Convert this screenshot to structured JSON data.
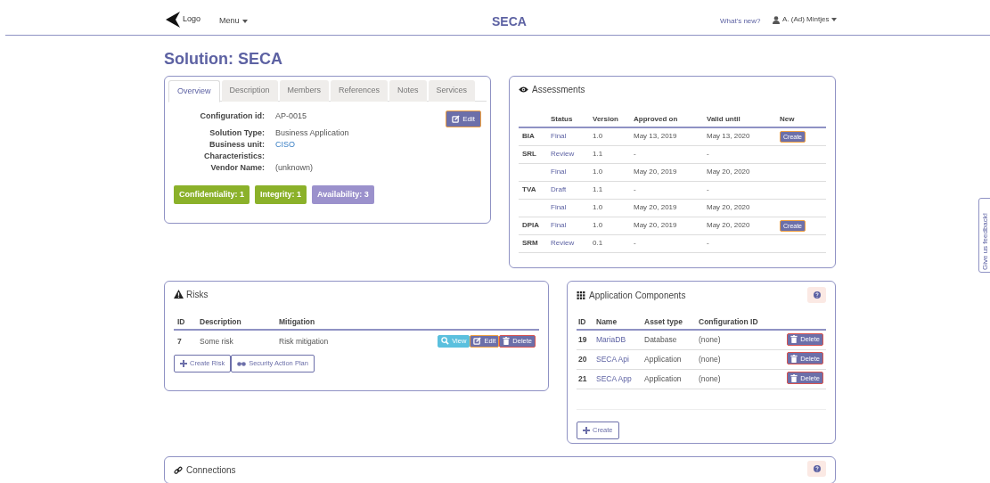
{
  "header": {
    "logo_text": "Logo",
    "menu": "Menu",
    "app_title": "SECA",
    "whats_new": "What's new?",
    "user": "A. (Ad) Mintjes"
  },
  "page_title": "Solution: SECA",
  "overview": {
    "tabs": [
      {
        "label": "Overview",
        "selected": true
      },
      {
        "label": "Description",
        "selected": false
      },
      {
        "label": "Members",
        "selected": false
      },
      {
        "label": "References",
        "selected": false
      },
      {
        "label": "Notes",
        "selected": false
      },
      {
        "label": "Services",
        "selected": false
      }
    ],
    "edit_button": "Edit",
    "fields": [
      {
        "label": "Configuration id:",
        "value": "AP-0015",
        "kind": "text"
      },
      {
        "label": "Solution Type:",
        "value": "Business Application",
        "kind": "text"
      },
      {
        "label": "Business unit:",
        "value": "CISO",
        "kind": "link"
      },
      {
        "label": "Characteristics:"
      },
      {
        "label": "Vendor Name:",
        "value": "(unknown)",
        "kind": "text"
      }
    ],
    "badges": [
      {
        "label": "Confidentiality: 1",
        "color": "#8bb12a"
      },
      {
        "label": "Integrity: 1",
        "color": "#8bb12a"
      },
      {
        "label": "Availability: 3",
        "color": "#9b91cc"
      }
    ]
  },
  "assessments": {
    "title": "Assessments",
    "columns": [
      "Status",
      "Version",
      "Approved on",
      "Valid until",
      "New"
    ],
    "rows": [
      {
        "type": "BIA",
        "status": "Final",
        "version": "1.0",
        "approved_on": "May 13, 2019",
        "valid_until": "May 13, 2020",
        "new_button": "Create"
      },
      {
        "type": "SRL",
        "status": "Review",
        "version": "1.1",
        "approved_on": "-",
        "valid_until": "-"
      },
      {
        "status": "Final",
        "version": "1.0",
        "approved_on": "May 20, 2019",
        "valid_until": "May 20, 2020"
      },
      {
        "type": "TVA",
        "status": "Draft",
        "version": "1.1",
        "approved_on": "-",
        "valid_until": "-"
      },
      {
        "status": "Final",
        "version": "1.0",
        "approved_on": "May 20, 2019",
        "valid_until": "May 20, 2020"
      },
      {
        "type": "DPIA",
        "status": "Final",
        "version": "1.0",
        "approved_on": "May 20, 2019",
        "valid_until": "May 20, 2020",
        "new_button": "Create"
      },
      {
        "type": "SRM",
        "status": "Review",
        "version": "0.1",
        "approved_on": "-",
        "valid_until": "-"
      }
    ]
  },
  "risks": {
    "title": "Risks",
    "columns": [
      "ID",
      "Description",
      "Mitigation"
    ],
    "rows": [
      {
        "id": "7",
        "description": "Some risk",
        "mitigation": "Risk mitigation",
        "actions": [
          {
            "label": "View",
            "kind": "view"
          },
          {
            "label": "Edit",
            "kind": "edit"
          },
          {
            "label": "Delete",
            "kind": "delete"
          }
        ]
      }
    ],
    "buttons": [
      {
        "label": "Create Risk",
        "kind": "create"
      },
      {
        "label": "Security Action Plan",
        "kind": "plan"
      }
    ]
  },
  "components": {
    "title": "Application Components",
    "columns": [
      "ID",
      "Name",
      "Asset type",
      "Configuration ID"
    ],
    "rows": [
      {
        "id": "19",
        "name": "MariaDB",
        "asset_type": "Database",
        "configuration_id": "(none)",
        "action": "Delete"
      },
      {
        "id": "20",
        "name": "SECA Api",
        "asset_type": "Application",
        "configuration_id": "(none)",
        "action": "Delete"
      },
      {
        "id": "21",
        "name": "SECA App",
        "asset_type": "Application",
        "configuration_id": "(none)",
        "action": "Delete"
      }
    ],
    "create_button": "Create"
  },
  "connections": {
    "title": "Connections"
  },
  "feedback": "Give us feedback!"
}
